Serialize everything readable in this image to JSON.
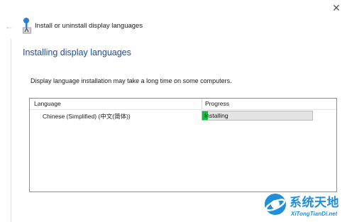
{
  "window": {
    "title": "Install or uninstall display languages",
    "back_icon": "back-arrow-icon",
    "close_icon": "close-icon"
  },
  "main": {
    "heading": "Installing display languages",
    "description": "Display language installation may take a long time on some computers."
  },
  "list": {
    "columns": [
      "Language",
      "Progress"
    ],
    "rows": [
      {
        "language": "Chinese (Simplified) (中文(简体))",
        "progress_text": "Installing",
        "progress_fraction": 0.05
      }
    ]
  },
  "watermark": {
    "title": "系统天地",
    "url": "XiTongTianDi.net"
  },
  "colors": {
    "heading": "#1c4da1",
    "progress_fill": "#0fbf3f",
    "watermark": "#1f8fdc"
  }
}
